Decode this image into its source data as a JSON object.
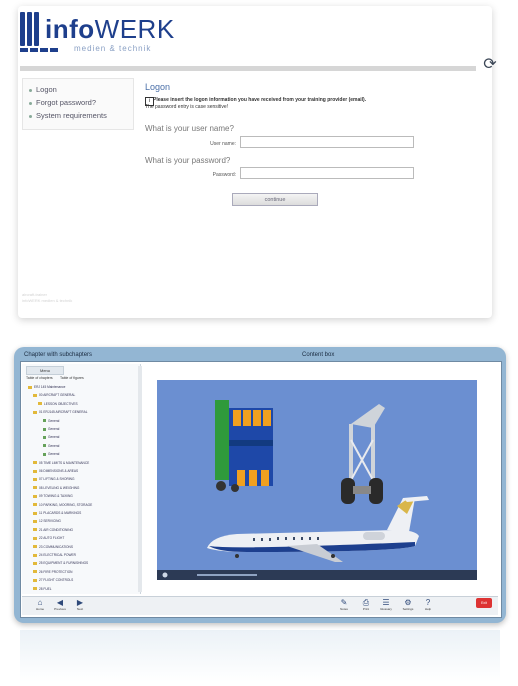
{
  "logo": {
    "brand_bold": "info",
    "brand_light": "WERK",
    "tagline": "medien & technik"
  },
  "menu": {
    "items": [
      "Logon",
      "Forgot password?",
      "System requirements"
    ]
  },
  "form": {
    "title": "Logon",
    "info_line1": "Please insert the logon information you have received from your training provider (email).",
    "info_line2": "The password entry is case sensitive!",
    "question_user": "What is your user name?",
    "label_user": "User name:",
    "user_value": "",
    "question_password": "What is your password?",
    "label_password": "Password:",
    "password_value": "",
    "continue_label": "continue"
  },
  "footer": {
    "line1": "aircraft-trainer",
    "line2": "infoWERK medien & technik"
  },
  "annotations": {
    "left": "Chapter with subchapters",
    "right": "Content box"
  },
  "tree": {
    "head": "Menu",
    "tab1": "Table of chapters",
    "tab2": "Table of figures",
    "rows": [
      "ERJ 145 Maintenance",
      "00 AIRCRAFT GENERAL",
      "LESSON OBJECTIVES",
      "01 ERJ145 AIRCRAFT GENERAL",
      "General",
      "General",
      "General",
      "General",
      "General",
      "05 TIME LIMITS & MAINTENANCE",
      "06 DIMENSIONS & AREAS",
      "07 LIFTING & SHORING",
      "08 LEVELING & WEIGHING",
      "09 TOWING & TAXIING",
      "10 PARKING, MOORING, STORAGE",
      "11 PLACARDS & MARKINGS",
      "12 SERVICING",
      "21 AIR CONDITIONING",
      "22 AUTO FLIGHT",
      "23 COMMUNICATIONS",
      "24 ELECTRICAL POWER",
      "25 EQUIPMENT & FURNISHINGS",
      "26 FIRE PROTECTION",
      "27 FLIGHT CONTROLS",
      "28 FUEL"
    ]
  },
  "toolbar": {
    "left": [
      "Home",
      "Previous",
      "Next"
    ],
    "right": [
      "Notes",
      "Print",
      "Glossary",
      "Settings",
      "Help"
    ],
    "exit": "Exit"
  },
  "colors": {
    "brand": "#1e3f8c",
    "content_bg": "#6b8fd1",
    "frame": "#93b6d3"
  }
}
